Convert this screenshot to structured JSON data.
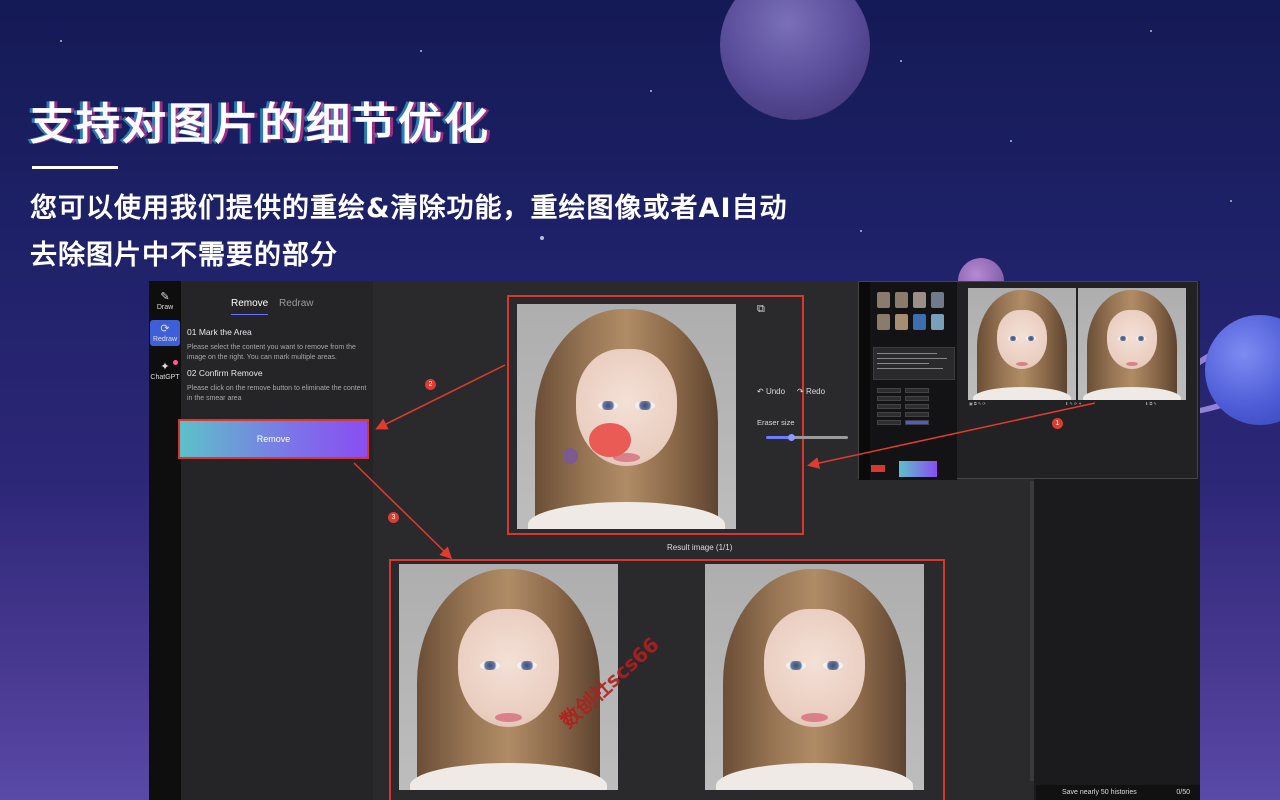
{
  "hero": {
    "title": "支持对图片的细节优化",
    "line1": "您可以使用我们提供的重绘&清除功能，重绘图像或者AI自动",
    "line2": "去除图片中不需要的部分"
  },
  "rail": {
    "items": [
      {
        "label": "Draw",
        "icon": "brush-icon"
      },
      {
        "label": "Redraw",
        "icon": "refresh-icon",
        "active": true
      },
      {
        "label": "ChatGPT",
        "icon": "chatgpt-icon"
      }
    ]
  },
  "panel": {
    "tabs": [
      "Remove",
      "Redraw"
    ],
    "step1_title": "01 Mark the Area",
    "step1_desc": "Please select the content you want to remove from the image on the right. You can mark multiple areas.",
    "step2_title": "02 Confirm Remove",
    "step2_desc": "Please click on the remove button to eliminate the content in the smear area",
    "remove_label": "Remove"
  },
  "editor": {
    "undo_label": "Undo",
    "redo_label": "Redo",
    "eraser_label": "Eraser size",
    "eraser_value": 0.3,
    "result_caption": "Result image (1/1)"
  },
  "status": {
    "history_text": "Save nearly 50 histories",
    "count": "0/50"
  },
  "badges": [
    "1",
    "2",
    "3"
  ],
  "watermark": "数创社scs66",
  "colors": {
    "accent": "#3f5fd8",
    "highlight_box": "#d9362e",
    "button_gradient_start": "#5dc1c9",
    "button_gradient_end": "#8a4df2"
  }
}
